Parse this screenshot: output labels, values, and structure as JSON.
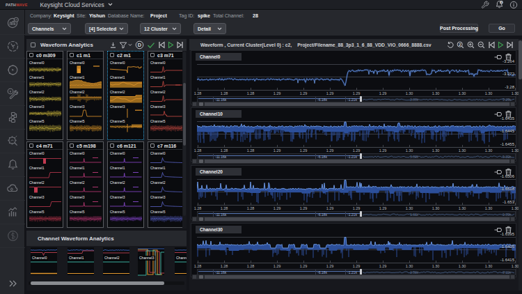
{
  "topbar": {
    "logo_path": "PATH",
    "logo_wave": "WAVE",
    "app_menu": "Keysight Cloud Services",
    "icons": [
      "wrench-icon",
      "notifications-bell-icon",
      "info-circle-icon"
    ]
  },
  "sidebar": {
    "items": [
      {
        "name": "analytics-globe"
      },
      {
        "name": "clock-meter"
      },
      {
        "name": "gear-automation"
      },
      {
        "name": "service-tools"
      },
      {
        "name": "flow-blocks"
      },
      {
        "name": "inspect-gear"
      },
      {
        "name": "notifications"
      },
      {
        "name": "cloud-settings"
      },
      {
        "name": "statistics"
      },
      {
        "name": "billing"
      }
    ],
    "expand": "chevron-double-right"
  },
  "infobar": {
    "fields": [
      {
        "label": "Company:",
        "value": "Keysight"
      },
      {
        "label": "Site:",
        "value": "Yishun"
      },
      {
        "label": "Database Name:",
        "value": "Project"
      },
      {
        "label": "Tag ID:",
        "value": "spike"
      },
      {
        "label": "Total Channel:",
        "value": "28"
      }
    ]
  },
  "filterbar": {
    "dropdowns": [
      {
        "label": "Channels"
      },
      {
        "label": "[4] Selected"
      },
      {
        "label": "12 Cluster"
      },
      {
        "label": "Detail"
      }
    ],
    "post_processing": "Post Processing",
    "go": "Go"
  },
  "cluster_panel": {
    "title": "Waveform Analytics",
    "row_labels": [
      "Channel0",
      "Channel1",
      "Channel2",
      "Channel3",
      "Channel5"
    ],
    "clusters": [
      {
        "id": "c0 m309",
        "color": "#d8c23c",
        "dim": "#8a7d2c",
        "selected": false,
        "kind": "noise"
      },
      {
        "id": "c1 m1",
        "color": "#e2952c",
        "dim": "#9a6a1e",
        "selected": false,
        "kind": "bands"
      },
      {
        "id": "c2 m1",
        "color": "#e2952c",
        "dim": "#9a6a1e",
        "selected": true,
        "kind": "steps"
      },
      {
        "id": "c3 m71",
        "color": "#cc4b44",
        "dim": "#8a332e",
        "selected": false,
        "kind": "spikes"
      },
      {
        "id": "c4 m71",
        "color": "#c23a50",
        "dim": "#7e2736",
        "selected": false,
        "kind": "pulses"
      },
      {
        "id": "c5 m198",
        "color": "#c23a78",
        "dim": "#7e2750",
        "selected": false,
        "kind": "ticks"
      },
      {
        "id": "c6 m121",
        "color": "#8a4ad2",
        "dim": "#5c3190",
        "selected": false,
        "kind": "ticks"
      },
      {
        "id": "c7 m116",
        "color": "#5b63c8",
        "dim": "#3d4288",
        "selected": false,
        "kind": "decay"
      }
    ]
  },
  "channel_panel": {
    "title": "Channel Waveform Analytics",
    "thumbs": [
      {
        "label": "Channel0",
        "kind": "flat"
      },
      {
        "label": "Channel1",
        "kind": "flat2"
      },
      {
        "label": "Channel2",
        "kind": "flat3"
      },
      {
        "label": "Channel3",
        "kind": "square"
      },
      {
        "label": "Channel5",
        "kind": "flat"
      }
    ],
    "trace_colors": [
      "#3e6fd0",
      "#d04858",
      "#3fbfae",
      "#e0962e",
      "#d84f9a"
    ]
  },
  "waveform_panel": {
    "title": "Waveform , Current Cluster(Level 0) : c2,",
    "file": "Project/Filename_88_3p3_1_6_88_VDD_VIO_0666_8888.csv",
    "head_icons": [
      "undo-icon",
      "zoom-2x-icon",
      "zoom-in-icon",
      "zoom-out-icon",
      "skip-back-icon",
      "play-icon",
      "skip-forward-icon"
    ],
    "x_ticks": [
      "1.28",
      "1.28",
      "1.28",
      "1.29",
      "1.29",
      "1.29",
      "1.29",
      "1.29",
      "1.30",
      "1.30",
      "1.30",
      "1.30",
      "1.30"
    ],
    "overview_labels": [
      "-11.16k",
      "-6.18k",
      "-1.21k"
    ],
    "overview_labels_right": [
      "3.88k",
      "9.39k"
    ],
    "wave_color": "#6f9ce8",
    "fill_color": "#2c4f9a",
    "strips": [
      {
        "label": "Channel0",
        "y_labels": [
          "-3.264",
          "-3.272",
          "-3.28"
        ],
        "kind": "noisestep"
      },
      {
        "label": "Channel10",
        "y_labels": [
          "-1.6435",
          "-1.6445",
          "-1.6455"
        ],
        "kind": "band"
      },
      {
        "label": "Channel20",
        "y_labels": [
          "-1.6506",
          "-1.6518",
          "-1.653"
        ],
        "kind": "band2"
      },
      {
        "label": "Channel30",
        "y_labels": [
          "-1.6395",
          "-1.6405",
          "-1.6415"
        ],
        "kind": "band3"
      }
    ]
  }
}
